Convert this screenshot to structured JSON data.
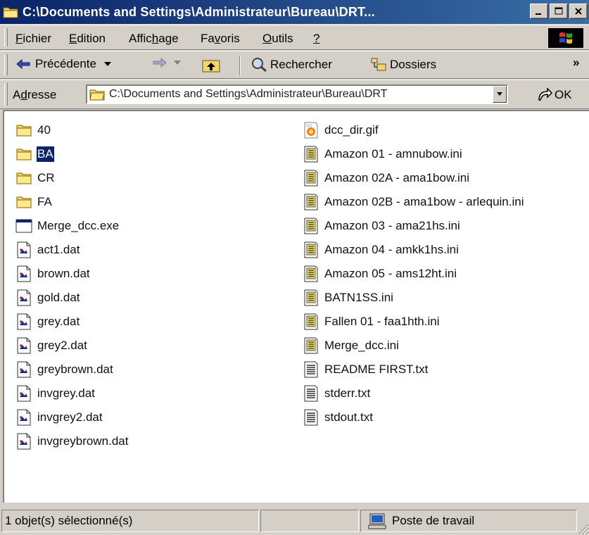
{
  "window": {
    "title": "C:\\Documents and Settings\\Administrateur\\Bureau\\DRT...",
    "buttons": [
      "minimize",
      "maximize",
      "close"
    ]
  },
  "menu": {
    "items": [
      {
        "label": "Fichier",
        "accel": "F"
      },
      {
        "label": "Edition",
        "accel": "E"
      },
      {
        "label": "Affichage",
        "accel": "h"
      },
      {
        "label": "Favoris",
        "accel": "v"
      },
      {
        "label": "Outils",
        "accel": "O"
      },
      {
        "label": "?",
        "accel": "?"
      }
    ]
  },
  "toolbar": {
    "back_label": "Précédente",
    "search_label": "Rechercher",
    "folders_label": "Dossiers",
    "more": "»"
  },
  "address": {
    "label": "Adresse",
    "value": "C:\\Documents and Settings\\Administrateur\\Bureau\\DRT",
    "go_label": "OK"
  },
  "files": {
    "column1": [
      {
        "name": "40",
        "icon": "folder-icon",
        "selected": false
      },
      {
        "name": "BA",
        "icon": "folder-icon",
        "selected": true
      },
      {
        "name": "CR",
        "icon": "folder-icon",
        "selected": false
      },
      {
        "name": "FA",
        "icon": "folder-icon",
        "selected": false
      },
      {
        "name": "Merge_dcc.exe",
        "icon": "exe-icon",
        "selected": false
      },
      {
        "name": "act1.dat",
        "icon": "dat-file-icon",
        "selected": false
      },
      {
        "name": "brown.dat",
        "icon": "dat-file-icon",
        "selected": false
      },
      {
        "name": "gold.dat",
        "icon": "dat-file-icon",
        "selected": false
      },
      {
        "name": "grey.dat",
        "icon": "dat-file-icon",
        "selected": false
      },
      {
        "name": "grey2.dat",
        "icon": "dat-file-icon",
        "selected": false
      },
      {
        "name": "greybrown.dat",
        "icon": "dat-file-icon",
        "selected": false
      },
      {
        "name": "invgrey.dat",
        "icon": "dat-file-icon",
        "selected": false
      },
      {
        "name": "invgrey2.dat",
        "icon": "dat-file-icon",
        "selected": false
      },
      {
        "name": "invgreybrown.dat",
        "icon": "dat-file-icon",
        "selected": false
      }
    ],
    "column2": [
      {
        "name": "dcc_dir.gif",
        "icon": "gif-file-icon"
      },
      {
        "name": "Amazon 01 - amnubow.ini",
        "icon": "ini-file-icon"
      },
      {
        "name": "Amazon 02A - ama1bow.ini",
        "icon": "ini-file-icon"
      },
      {
        "name": "Amazon 02B - ama1bow - arlequin.ini",
        "icon": "ini-file-icon"
      },
      {
        "name": "Amazon 03 - ama21hs.ini",
        "icon": "ini-file-icon"
      },
      {
        "name": "Amazon 04 - amkk1hs.ini",
        "icon": "ini-file-icon"
      },
      {
        "name": "Amazon 05 - ams12ht.ini",
        "icon": "ini-file-icon"
      },
      {
        "name": "BATN1SS.ini",
        "icon": "ini-file-icon"
      },
      {
        "name": "Fallen 01 - faa1hth.ini",
        "icon": "ini-file-icon"
      },
      {
        "name": "Merge_dcc.ini",
        "icon": "ini-file-icon"
      },
      {
        "name": "README FIRST.txt",
        "icon": "txt-file-icon"
      },
      {
        "name": "stderr.txt",
        "icon": "txt-file-icon"
      },
      {
        "name": "stdout.txt",
        "icon": "txt-file-icon"
      }
    ]
  },
  "status": {
    "selection_text": "1 objet(s) sélectionné(s)",
    "zone_text": "Poste de travail"
  },
  "colors": {
    "title_start": "#0a246a",
    "title_end": "#3a6ea5",
    "face": "#d4d0c8",
    "selection": "#0a246a"
  }
}
